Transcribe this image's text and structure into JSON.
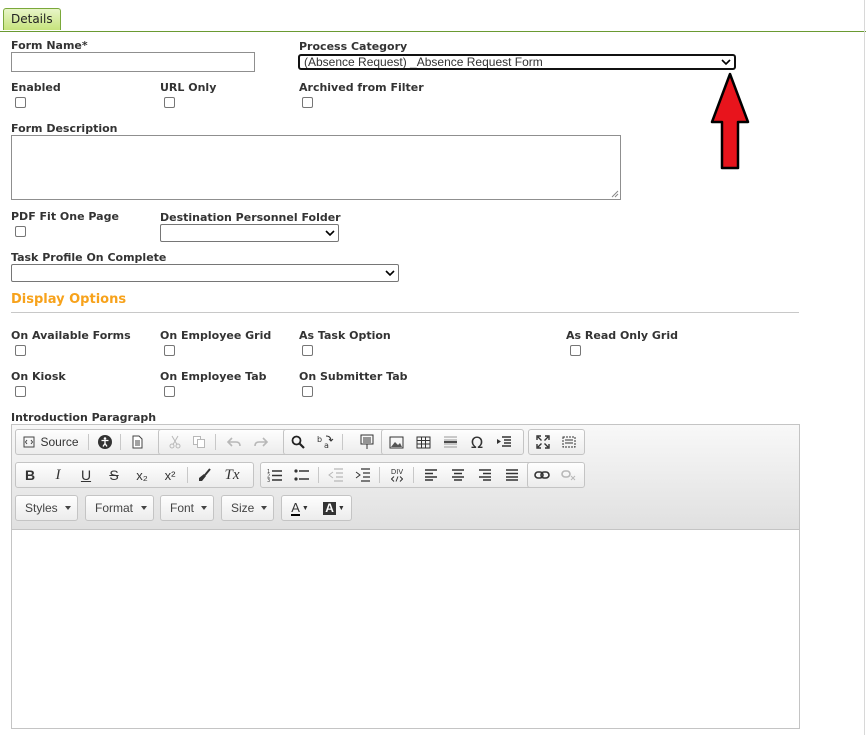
{
  "tabs": {
    "details": "Details"
  },
  "form": {
    "form_name_label": "Form Name*",
    "form_name_value": "",
    "process_category_label": "Process Category",
    "process_category_value": "(Absence Request) _Absence Request Form",
    "enabled_label": "Enabled",
    "url_only_label": "URL Only",
    "archived_label": "Archived from Filter",
    "description_label": "Form Description",
    "description_value": "",
    "pdf_fit_label": "PDF Fit One Page",
    "destination_folder_label": "Destination Personnel Folder",
    "destination_folder_value": "",
    "task_profile_label": "Task Profile On Complete",
    "task_profile_value": ""
  },
  "display_options": {
    "heading": "Display Options",
    "on_available_forms": "On Available Forms",
    "on_employee_grid": "On Employee Grid",
    "as_task_option": "As Task Option",
    "as_read_only_grid": "As Read Only Grid",
    "on_kiosk": "On Kiosk",
    "on_employee_tab": "On Employee Tab",
    "on_submitter_tab": "On Submitter Tab"
  },
  "intro": {
    "label": "Introduction Paragraph"
  },
  "editor": {
    "source_label": "Source",
    "styles_label": "Styles",
    "format_label": "Format",
    "font_label": "Font",
    "size_label": "Size",
    "bold": "B",
    "italic": "I",
    "underline": "U",
    "strike": "S",
    "subscript": "x₂",
    "superscript": "x²",
    "clear_format": "Tx",
    "special_char": "Ω",
    "div": "DIV",
    "text_color": "A",
    "bg_color": "A"
  },
  "colors": {
    "accent": "#f7a21b",
    "arrow": "#e8141c",
    "tab": "#c6e37c"
  },
  "icons": [
    "source-icon",
    "accessibility-icon",
    "templates-icon",
    "cut-icon",
    "copy-icon",
    "undo-icon",
    "redo-icon",
    "find-icon",
    "replace-icon",
    "paste-icon",
    "image-icon",
    "table-icon",
    "horizontal-rule-icon",
    "special-char-icon",
    "indent-block-icon",
    "maximize-icon",
    "show-blocks-icon",
    "link-icon",
    "unlink-icon",
    "numbered-list-icon",
    "bulleted-list-icon",
    "outdent-icon",
    "indent-icon",
    "align-left-icon",
    "align-center-icon",
    "align-right-icon",
    "justify-icon"
  ]
}
